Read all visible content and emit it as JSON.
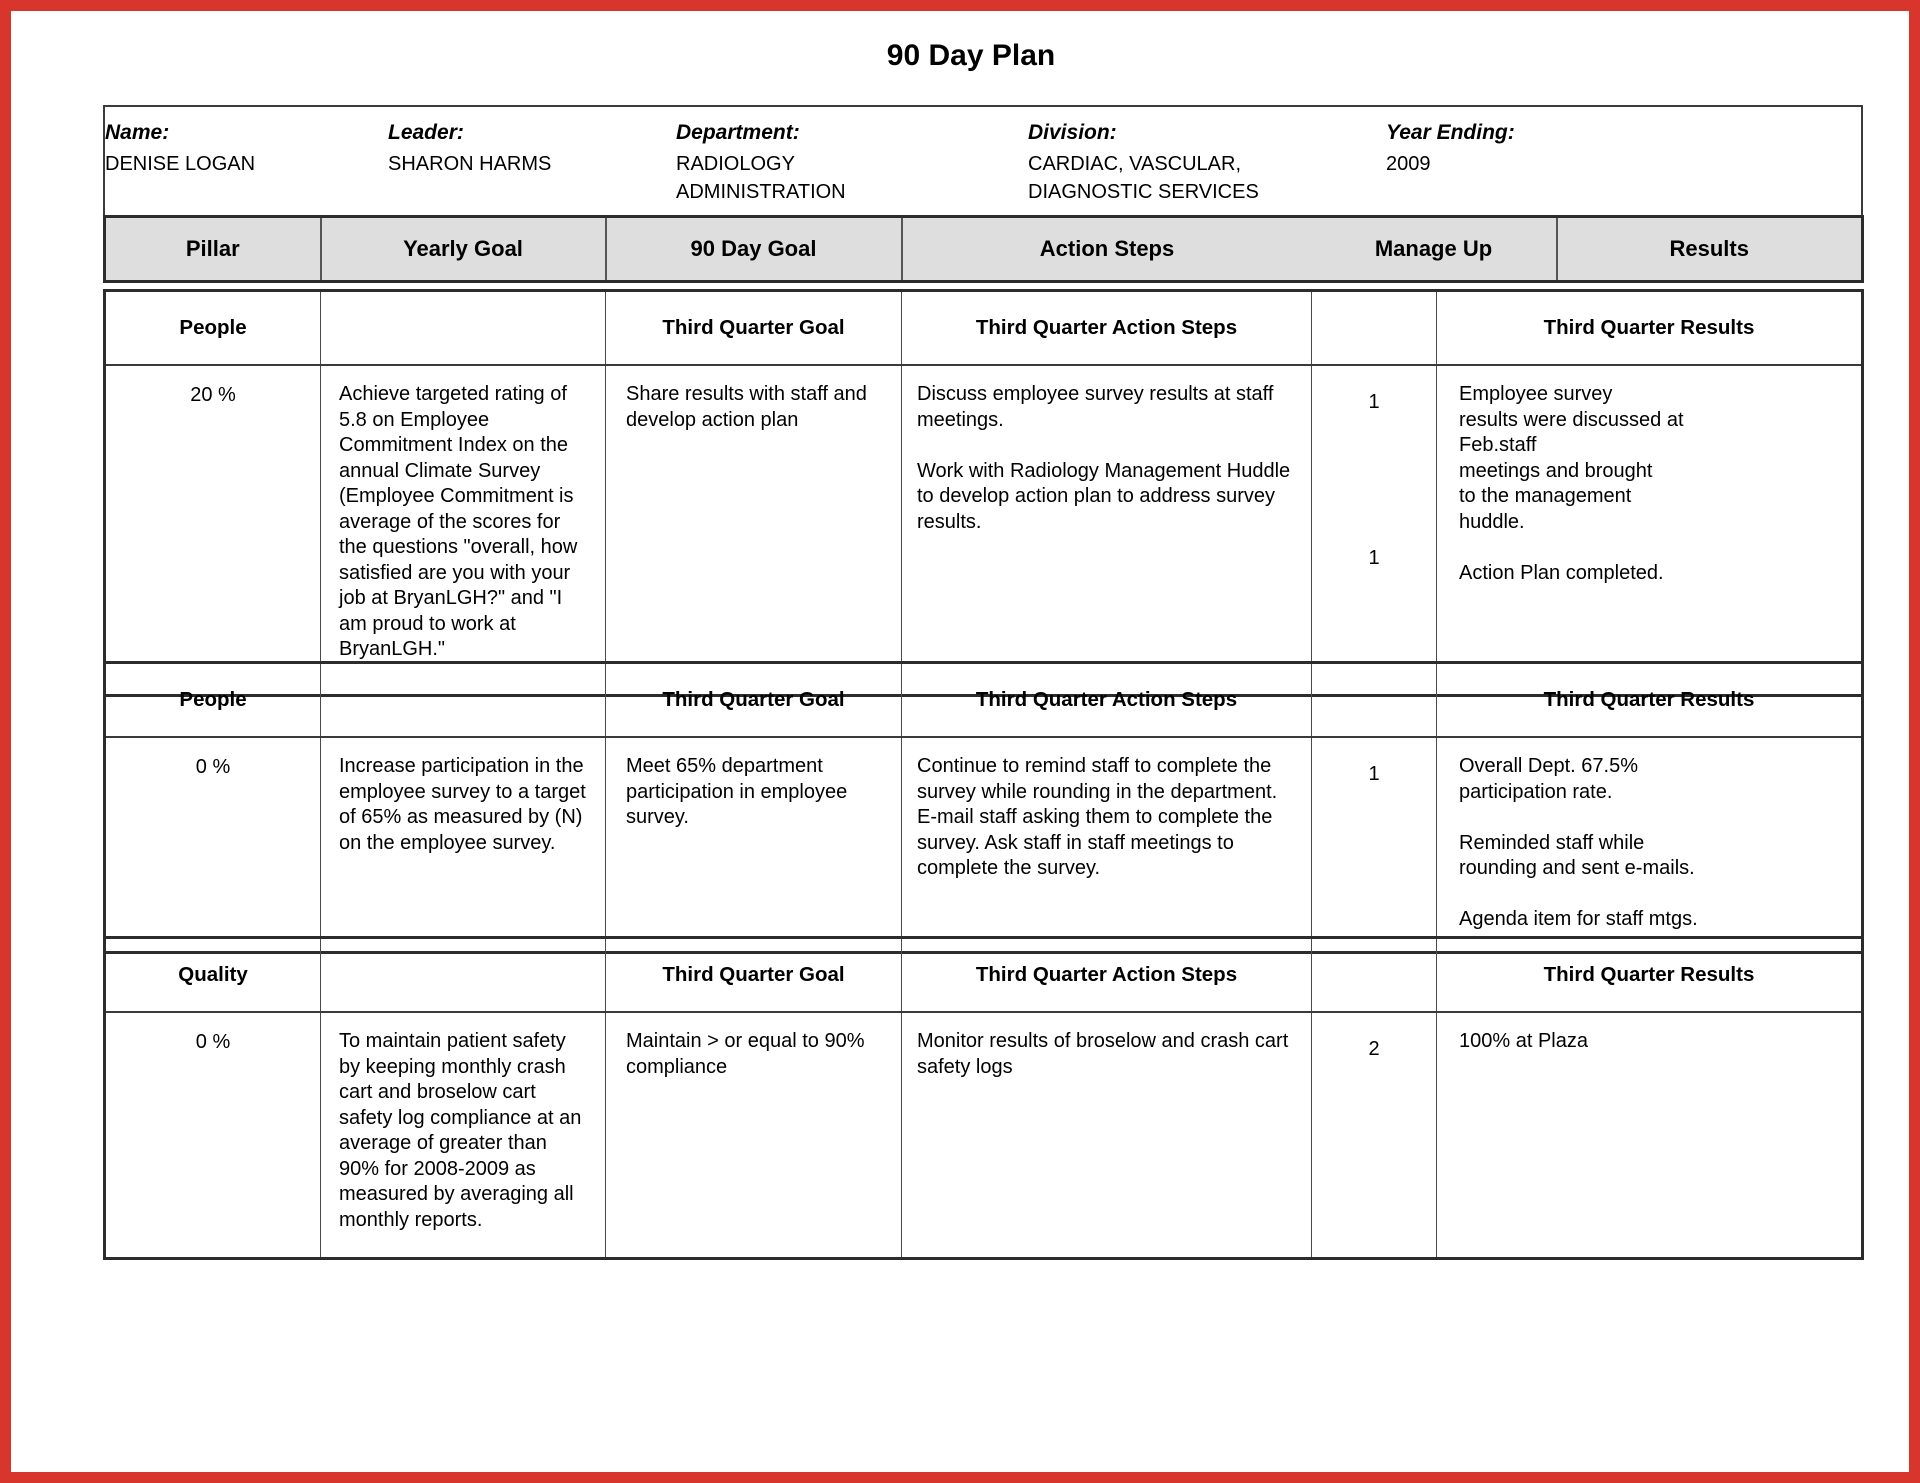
{
  "document": {
    "title": "90 Day Plan"
  },
  "info": {
    "fields": [
      {
        "label": "Name:",
        "value": "DENISE LOGAN"
      },
      {
        "label": "Leader:",
        "value": "SHARON HARMS"
      },
      {
        "label": "Department:",
        "value": "RADIOLOGY\nADMINISTRATION"
      },
      {
        "label": "Division:",
        "value": "CARDIAC, VASCULAR,\nDIAGNOSTIC SERVICES"
      },
      {
        "label": "Year Ending:",
        "value": "2009"
      }
    ]
  },
  "table": {
    "columns": [
      {
        "label": "Pillar"
      },
      {
        "label": "Yearly Goal"
      },
      {
        "label": "90 Day Goal"
      },
      {
        "label": "Action Steps"
      },
      {
        "label": "Manage Up"
      },
      {
        "label": "Results"
      }
    ],
    "sections": [
      {
        "subheader": {
          "pillar": "People",
          "yearly_goal": "",
          "day_goal": "Third  Quarter Goal",
          "action_steps": "Third  Quarter Action Steps",
          "manage_up": "",
          "results": "Third  Quarter Results"
        },
        "row": {
          "pillar": "20 %",
          "yearly_goal": "Achieve targeted rating of 5.8 on Employee Commitment Index on the annual Climate Survey (Employee Commitment is average of the scores for the questions \"overall, how satisfied are you with your job at BryanLGH?\" and \"I am proud to work at BryanLGH.\"",
          "day_goal": "Share results with staff and develop action plan",
          "action_steps": "Discuss employee survey results at staff meetings.\n\nWork with Radiology Management Huddle to develop action plan to address survey results.",
          "manage_up": "1\n\n\n\n1",
          "results": "Employee survey\nresults were discussed at\nFeb.staff\nmeetings and brought\nto the management\nhuddle.\n\nAction Plan completed."
        }
      },
      {
        "subheader": {
          "pillar": "People",
          "yearly_goal": "",
          "day_goal": "Third  Quarter Goal",
          "action_steps": "Third  Quarter Action Steps",
          "manage_up": "",
          "results": "Third  Quarter Results"
        },
        "row": {
          "pillar": "0 %",
          "yearly_goal": "Increase participation in the employee survey to a target of 65% as measured by (N) on the employee survey.",
          "day_goal": "Meet 65% department participation in employee survey.",
          "action_steps": "Continue to remind staff to complete the survey while rounding in the department.  E-mail staff asking them to complete the survey.  Ask staff in staff meetings to complete the survey.",
          "manage_up": "1",
          "results": "Overall Dept. 67.5%\nparticipation rate.\n\nReminded staff while\nrounding and sent e-mails.\n\nAgenda item for staff mtgs."
        }
      },
      {
        "subheader": {
          "pillar": "Quality",
          "yearly_goal": "",
          "day_goal": "Third  Quarter Goal",
          "action_steps": "Third  Quarter Action Steps",
          "manage_up": "",
          "results": "Third  Quarter Results"
        },
        "row": {
          "pillar": "0 %",
          "yearly_goal": "To maintain patient safety by keeping monthly crash cart and broselow cart safety log compliance at an average of greater than 90% for 2008-2009 as measured by averaging all monthly reports.",
          "day_goal": "Maintain > or equal to 90% compliance",
          "action_steps": "Monitor results of broselow and crash cart safety logs",
          "manage_up": "2",
          "results": "100% at Plaza"
        }
      }
    ]
  },
  "colors": {
    "frame": "#d8352d",
    "header_fill": "#dedede",
    "rule": "#3a3a3a"
  }
}
